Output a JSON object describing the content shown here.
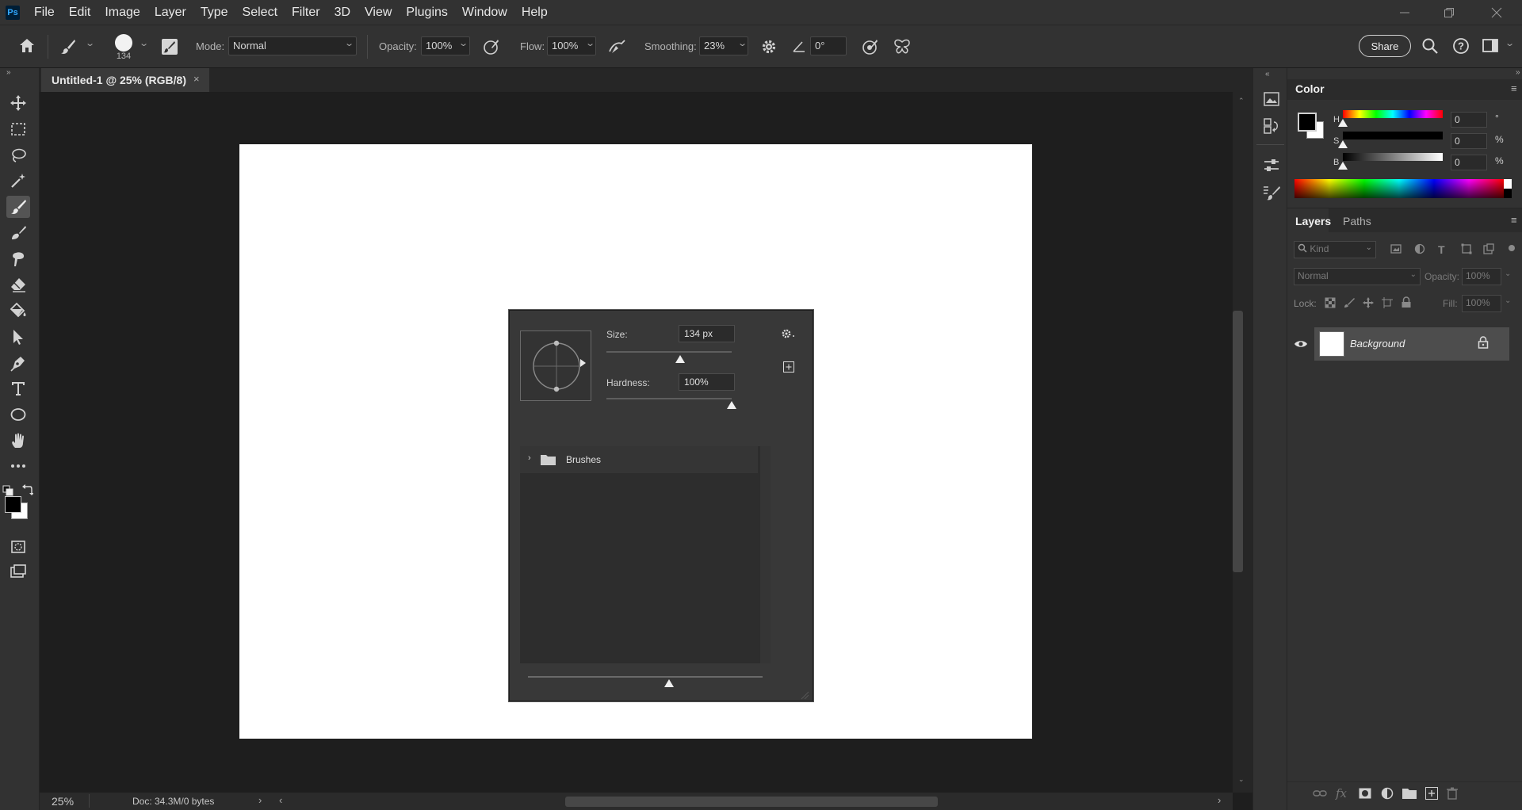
{
  "app": {
    "logo": "Ps",
    "menu": [
      "File",
      "Edit",
      "Image",
      "Layer",
      "Type",
      "Select",
      "Filter",
      "3D",
      "View",
      "Plugins",
      "Window",
      "Help"
    ]
  },
  "options": {
    "brush_size": "134",
    "mode_label": "Mode:",
    "mode_value": "Normal",
    "opacity_label": "Opacity:",
    "opacity_value": "100%",
    "flow_label": "Flow:",
    "flow_value": "100%",
    "smoothing_label": "Smoothing:",
    "smoothing_value": "23%",
    "angle_value": "0°",
    "share_label": "Share"
  },
  "document": {
    "tab_title": "Untitled-1 @ 25% (RGB/8)"
  },
  "brush_popup": {
    "size_label": "Size:",
    "size_value": "134 px",
    "size_fraction": 0.59,
    "hardness_label": "Hardness:",
    "hardness_value": "100%",
    "hardness_fraction": 1.0,
    "folder_label": "Brushes",
    "preview_size_fraction": 0.6
  },
  "status": {
    "zoom": "25%",
    "doc_info": "Doc: 34.3M/0 bytes"
  },
  "color_panel": {
    "title": "Color",
    "h_label": "H",
    "h_value": "0",
    "h_unit": "°",
    "s_label": "S",
    "s_value": "0",
    "s_unit": "%",
    "b_label": "B",
    "b_value": "0",
    "b_unit": "%"
  },
  "layers_panel": {
    "tab_layers": "Layers",
    "tab_paths": "Paths",
    "kind_placeholder": "Kind",
    "blend_mode": "Normal",
    "opacity_label": "Opacity:",
    "opacity_value": "100%",
    "lock_label": "Lock:",
    "fill_label": "Fill:",
    "fill_value": "100%",
    "layer_name": "Background"
  },
  "colors": {
    "app_bg": "#323232",
    "canvas_bg": "#1e1e1e",
    "accent": "#31a8ff"
  }
}
